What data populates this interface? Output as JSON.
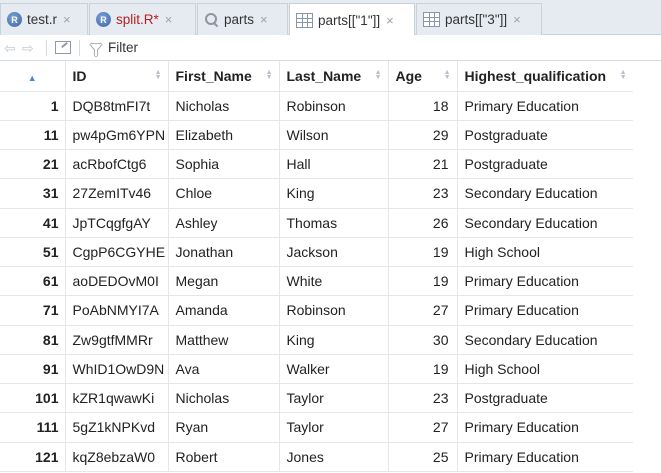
{
  "tabs": [
    {
      "label": "test.r",
      "icon": "r-file-icon",
      "modified": false,
      "active": false
    },
    {
      "label": "split.R*",
      "icon": "r-file-icon",
      "modified": true,
      "active": false
    },
    {
      "label": "parts",
      "icon": "search-icon",
      "modified": false,
      "active": false
    },
    {
      "label": "parts[[\"1\"]]",
      "icon": "data-grid-icon",
      "modified": false,
      "active": true
    },
    {
      "label": "parts[[\"3\"]]",
      "icon": "data-grid-icon",
      "modified": false,
      "active": false
    }
  ],
  "close_glyph": "×",
  "toolbar": {
    "filter_label": "Filter"
  },
  "table": {
    "columns": [
      "ID",
      "First_Name",
      "Last_Name",
      "Age",
      "Highest_qualification"
    ],
    "rows": [
      [
        "1",
        "DQB8tmFI7t",
        "Nicholas",
        "Robinson",
        "18",
        "Primary Education"
      ],
      [
        "11",
        "pw4pGm6YPN",
        "Elizabeth",
        "Wilson",
        "29",
        "Postgraduate"
      ],
      [
        "21",
        "acRbofCtg6",
        "Sophia",
        "Hall",
        "21",
        "Postgraduate"
      ],
      [
        "31",
        "27ZemITv46",
        "Chloe",
        "King",
        "23",
        "Secondary Education"
      ],
      [
        "41",
        "JpTCqgfgAY",
        "Ashley",
        "Thomas",
        "26",
        "Secondary Education"
      ],
      [
        "51",
        "CgpP6CGYHE",
        "Jonathan",
        "Jackson",
        "19",
        "High School"
      ],
      [
        "61",
        "aoDEDOvM0I",
        "Megan",
        "White",
        "19",
        "Primary Education"
      ],
      [
        "71",
        "PoAbNMYI7A",
        "Amanda",
        "Robinson",
        "27",
        "Primary Education"
      ],
      [
        "81",
        "Zw9gtfMMRr",
        "Matthew",
        "King",
        "30",
        "Secondary Education"
      ],
      [
        "91",
        "WhID1OwD9N",
        "Ava",
        "Walker",
        "19",
        "High School"
      ],
      [
        "101",
        "kZR1qwawKi",
        "Nicholas",
        "Taylor",
        "23",
        "Postgraduate"
      ],
      [
        "111",
        "5gZ1kNPKvd",
        "Ryan",
        "Taylor",
        "27",
        "Primary Education"
      ],
      [
        "121",
        "kqZ8ebzaW0",
        "Robert",
        "Jones",
        "25",
        "Primary Education"
      ]
    ]
  },
  "colors": {
    "modified_tab_text": "#b22222",
    "sort_active": "#3d8bd6",
    "tabbar_bg": "#e6ebf1"
  }
}
